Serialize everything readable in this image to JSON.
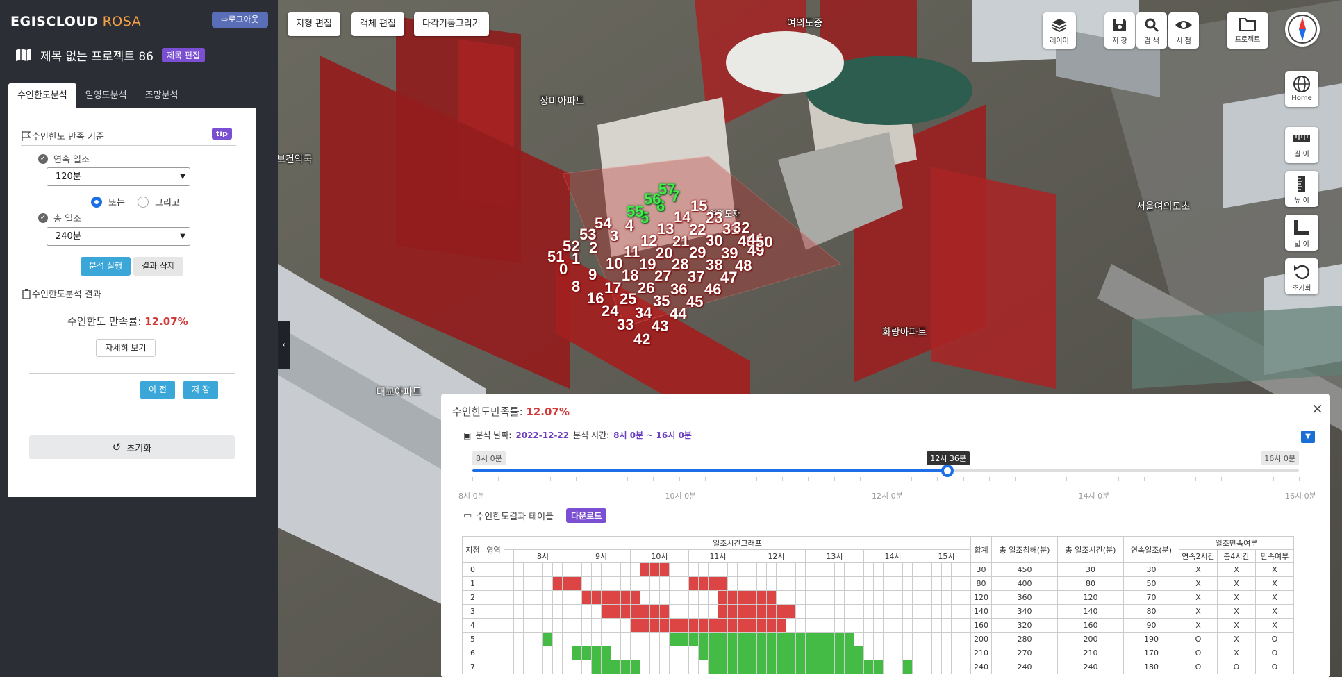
{
  "app": {
    "brand": "EGISCLOUD",
    "brand_sub": "ROSA",
    "logout": "로그아웃"
  },
  "project": {
    "title": "제목 없는 프로젝트 86",
    "edit_title": "제목 편집"
  },
  "tabs": [
    "수인한도분석",
    "일영도분석",
    "조망분석"
  ],
  "criteria": {
    "heading": "수인한도 만족 기준",
    "tip": "tip",
    "continuous_label": "연속 일조",
    "continuous_value": "120분",
    "or_label": "또는",
    "and_label": "그리고",
    "total_label": "총 일조",
    "total_value": "240분",
    "run": "분석 실행",
    "delete": "결과 삭제"
  },
  "result": {
    "heading": "수인한도분석 결과",
    "label": "수인한도 만족률:",
    "value": "12.07%",
    "detail": "자세히 보기",
    "prev": "이 전",
    "save": "저 장",
    "reset": "초기화"
  },
  "toolbar": {
    "terrain": "지형 편집",
    "object": "객체 편집",
    "polygon": "다각기둥그리기"
  },
  "right_tools": {
    "layer": "레이어",
    "save": "저 장",
    "search": "검 색",
    "view": "시 점",
    "project": "프로젝트",
    "home": "Home",
    "length": "길 이",
    "height": "높 이",
    "area": "넓 이",
    "reset": "초기화"
  },
  "map_labels": [
    "여의도중",
    "장미아파트",
    "보건약국",
    "서울여의도초",
    "화랑아파트",
    "대교아파트",
    "여의도자"
  ],
  "points_red": [
    "0",
    "1",
    "2",
    "3",
    "4",
    "8",
    "9",
    "10",
    "11",
    "12",
    "13",
    "14",
    "15",
    "16",
    "17",
    "18",
    "19",
    "20",
    "21",
    "22",
    "23",
    "24",
    "25",
    "26",
    "27",
    "28",
    "29",
    "30",
    "31",
    "32",
    "33",
    "34",
    "35",
    "36",
    "37",
    "38",
    "39",
    "40",
    "41",
    "42",
    "43",
    "44",
    "45",
    "46",
    "47",
    "48",
    "49",
    "50",
    "51",
    "52",
    "53",
    "54"
  ],
  "points_green": [
    "5",
    "6",
    "7",
    "55",
    "56",
    "57"
  ],
  "bottom": {
    "title": "수인한도만족률:",
    "value": "12.07%",
    "date_label": "분석 날짜:",
    "date": "2022-12-22",
    "time_label": "분석 시간:",
    "time": "8시 0분 ~ 16시 0분",
    "start": "8시 0분",
    "end": "16시 0분",
    "current": "12시 36분",
    "current_fraction": 0.575,
    "ticks": [
      "8시 0분",
      "10시 0분",
      "12시 0분",
      "14시 0분",
      "16시 0분"
    ],
    "table_title": "수인한도결과 테이블",
    "download": "다운로드"
  },
  "table": {
    "headers": {
      "point": "지점",
      "area": "영역",
      "graph": "일조시간그래프",
      "sum": "합계",
      "total_shadow": "총 일조침해(분)",
      "total_sun": "총 일조시간(분)",
      "cont_sun": "연속일조(분)",
      "sat": "일조만족여부",
      "cont2": "연속2시간",
      "total4": "총4시간",
      "satisfy": "만족여부"
    },
    "hours": [
      "8시",
      "9시",
      "10시",
      "11시",
      "12시",
      "13시",
      "14시",
      "15시"
    ],
    "rows": [
      {
        "id": "0",
        "sum": "30",
        "shadow": "450",
        "sun": "30",
        "cont": "30",
        "c2": "X",
        "t4": "X",
        "ok": "X",
        "color": "red",
        "on": [
          14,
          15,
          16
        ]
      },
      {
        "id": "1",
        "sum": "80",
        "shadow": "400",
        "sun": "80",
        "cont": "50",
        "c2": "X",
        "t4": "X",
        "ok": "X",
        "color": "red",
        "on": [
          5,
          6,
          7,
          19,
          20,
          21,
          22
        ]
      },
      {
        "id": "2",
        "sum": "120",
        "shadow": "360",
        "sun": "120",
        "cont": "70",
        "c2": "X",
        "t4": "X",
        "ok": "X",
        "color": "red",
        "on": [
          8,
          9,
          10,
          11,
          12,
          13,
          22,
          23,
          24,
          25,
          26,
          27
        ]
      },
      {
        "id": "3",
        "sum": "140",
        "shadow": "340",
        "sun": "140",
        "cont": "80",
        "c2": "X",
        "t4": "X",
        "ok": "X",
        "color": "red",
        "on": [
          10,
          11,
          12,
          13,
          14,
          15,
          16,
          22,
          23,
          24,
          25,
          26,
          27,
          28,
          29
        ]
      },
      {
        "id": "4",
        "sum": "160",
        "shadow": "320",
        "sun": "160",
        "cont": "90",
        "c2": "X",
        "t4": "X",
        "ok": "X",
        "color": "red",
        "on": [
          13,
          14,
          15,
          16,
          17,
          18,
          19,
          20,
          21,
          22,
          23,
          24,
          25,
          26,
          27,
          28
        ]
      },
      {
        "id": "5",
        "sum": "200",
        "shadow": "280",
        "sun": "200",
        "cont": "190",
        "c2": "O",
        "t4": "X",
        "ok": "O",
        "color": "green",
        "on": [
          4,
          17,
          18,
          19,
          20,
          21,
          22,
          23,
          24,
          25,
          26,
          27,
          28,
          29,
          30,
          31,
          32,
          33,
          34,
          35
        ]
      },
      {
        "id": "6",
        "sum": "210",
        "shadow": "270",
        "sun": "210",
        "cont": "170",
        "c2": "O",
        "t4": "X",
        "ok": "O",
        "color": "green",
        "on": [
          7,
          8,
          9,
          10,
          20,
          21,
          22,
          23,
          24,
          25,
          26,
          27,
          28,
          29,
          30,
          31,
          32,
          33,
          34,
          35,
          36
        ]
      },
      {
        "id": "7",
        "sum": "240",
        "shadow": "240",
        "sun": "240",
        "cont": "180",
        "c2": "O",
        "t4": "O",
        "ok": "O",
        "color": "green",
        "on": [
          9,
          10,
          11,
          12,
          13,
          21,
          22,
          23,
          24,
          25,
          26,
          27,
          28,
          29,
          30,
          31,
          32,
          33,
          34,
          35,
          36,
          37,
          38,
          41
        ]
      }
    ]
  },
  "colors": {
    "accent": "#1d6fe8",
    "purple": "#7b4fd1",
    "red": "#d44444",
    "green": "#44bb44"
  }
}
